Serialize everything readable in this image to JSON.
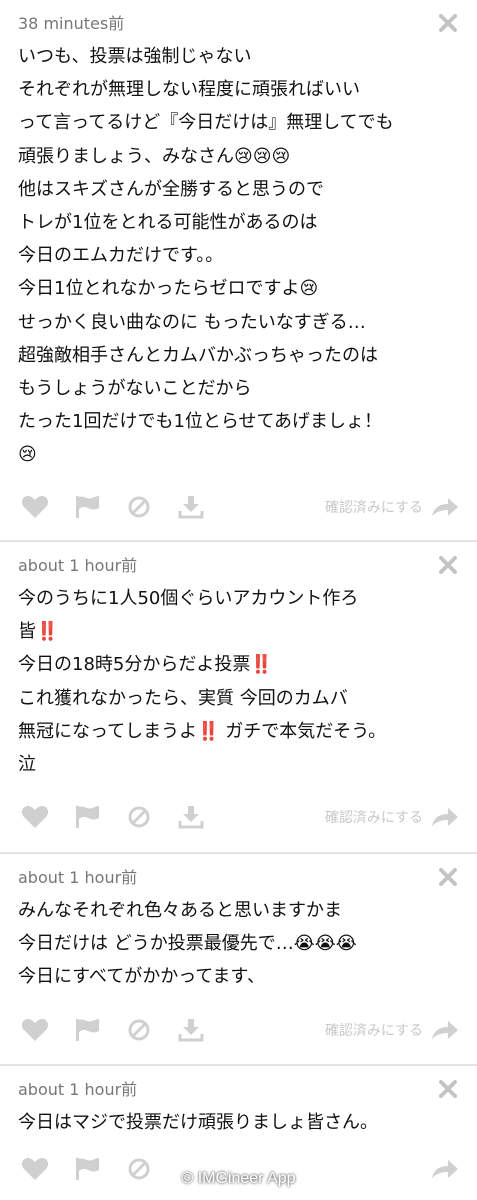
{
  "posts": [
    {
      "time": "38 minutes前",
      "lines": [
        "いつも、投票は強制じゃない",
        "それぞれが無理しない程度に頑張ればいい",
        "って言ってるけど『今日だけは』無理してでも",
        "頑張りましょう、みなさん😢😢😢",
        "他はスキズさんが全勝すると思うので",
        "トレが1位をとれる可能性があるのは",
        "今日のエムカだけです。。",
        "今日1位とれなかったらゼロですよ😢",
        "せっかく良い曲なのに もったいなすぎる…",
        "超強敵相手さんとカムバかぶっちゃったのは",
        "もうしょうがないことだから",
        "たった1回だけでも1位とらせてあげましょ！",
        "😢"
      ],
      "confirm": "確認済みにする"
    },
    {
      "time": "about 1 hour前",
      "lines": [
        "今のうちに1人50個ぐらいアカウント作ろ",
        "皆‼️",
        "今日の18時5分からだよ投票‼️",
        "これ獲れなかったら、実質 今回のカムバ",
        "無冠になってしまうよ‼️ ガチで本気だそう。",
        "泣"
      ],
      "confirm": "確認済みにする"
    },
    {
      "time": "about 1 hour前",
      "lines": [
        "みんなそれぞれ色々あると思いますかま",
        "今日だけは どうか投票最優先で…😭😭😭",
        "今日にすべてがかかってます、"
      ],
      "confirm": "確認済みにする"
    },
    {
      "time": "about 1 hour前",
      "lines": [
        "今日はマジで投票だけ頑張りましょ皆さん。"
      ],
      "confirm": ""
    }
  ],
  "watermark": "© IMGineer App",
  "icons": [
    "heart-icon",
    "flag-icon",
    "block-icon",
    "download-icon",
    "share-arrow-icon",
    "close-icon"
  ]
}
